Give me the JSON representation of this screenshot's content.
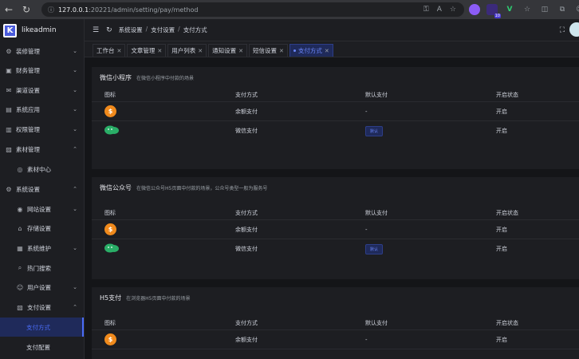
{
  "browser": {
    "url_host": "127.0.0.1",
    "url_rest": ":20221/admin/setting/pay/method",
    "ext_badge": "10"
  },
  "sidebar": {
    "logo_letter": "K",
    "app_name": "likeadmin",
    "items": [
      {
        "label": "装修管理",
        "icon": "⚙",
        "chev": "⌄"
      },
      {
        "label": "财务管理",
        "icon": "▣",
        "chev": "⌄"
      },
      {
        "label": "渠道设置",
        "icon": "✉",
        "chev": "⌄"
      },
      {
        "label": "系统应用",
        "icon": "▤",
        "chev": "⌄"
      },
      {
        "label": "权限管理",
        "icon": "▥",
        "chev": "⌄"
      },
      {
        "label": "素材管理",
        "icon": "▨",
        "chev": "⌃"
      },
      {
        "label": "素材中心",
        "icon": "◎",
        "chev": ""
      },
      {
        "label": "系统设置",
        "icon": "⚙",
        "chev": "⌃"
      },
      {
        "label": "网站设置",
        "icon": "◉",
        "chev": "⌄"
      },
      {
        "label": "存储设置",
        "icon": "⌂",
        "chev": ""
      },
      {
        "label": "系统维护",
        "icon": "▦",
        "chev": "⌄"
      },
      {
        "label": "热门搜索",
        "icon": "⌕",
        "chev": ""
      },
      {
        "label": "用户设置",
        "icon": "☺",
        "chev": "⌄"
      },
      {
        "label": "支付设置",
        "icon": "▧",
        "chev": "⌃"
      },
      {
        "label": "支付方式",
        "icon": "",
        "chev": ""
      },
      {
        "label": "支付配置",
        "icon": "",
        "chev": ""
      }
    ]
  },
  "header": {
    "breadcrumb": [
      "系统设置",
      "支付设置",
      "支付方式"
    ]
  },
  "tabs": [
    {
      "label": "工作台"
    },
    {
      "label": "文章管理"
    },
    {
      "label": "用户列表"
    },
    {
      "label": "通知设置"
    },
    {
      "label": "短信设置"
    },
    {
      "label": "支付方式"
    }
  ],
  "table_headers": [
    "图标",
    "支付方式",
    "默认支付",
    "开启状态"
  ],
  "sections": [
    {
      "title": "微信小程序",
      "desc": "在微信小程序中付款的场景",
      "rows": [
        {
          "method": "余额支付",
          "default": "-",
          "status": "开启",
          "icon": "money-icon"
        },
        {
          "method": "微信支付",
          "default_badge": "默认",
          "status": "开启",
          "icon": "wechat-icon"
        }
      ]
    },
    {
      "title": "微信公众号",
      "desc": "在微信公众号H5页面中付款的场景，公众号类型一般为服务号",
      "rows": [
        {
          "method": "余额支付",
          "default": "-",
          "status": "开启",
          "icon": "money-icon"
        },
        {
          "method": "微信支付",
          "default_badge": "默认",
          "status": "开启",
          "icon": "wechat-icon"
        }
      ]
    },
    {
      "title": "H5支付",
      "desc": "在浏览器H5页面中付款的场景",
      "rows": [
        {
          "method": "余额支付",
          "default": "-",
          "status": "开启",
          "icon": "money-icon"
        }
      ]
    }
  ],
  "colors": {
    "accent": "#4a6cf7",
    "money": "#f08a1c",
    "wechat": "#2aae67"
  }
}
